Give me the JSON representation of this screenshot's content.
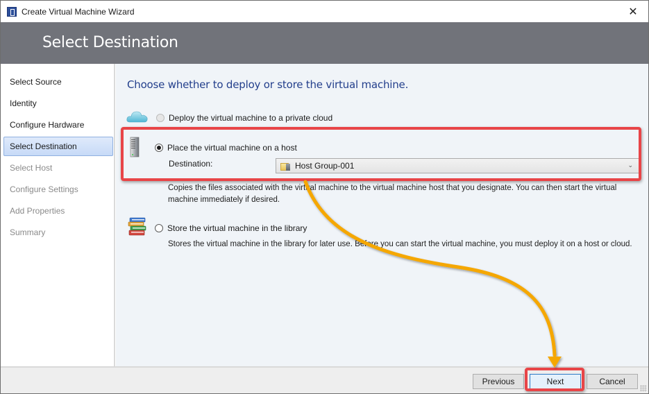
{
  "window": {
    "title": "Create Virtual Machine Wizard",
    "close_icon": "close-icon"
  },
  "header": {
    "title": "Select Destination"
  },
  "sidebar": {
    "items": [
      {
        "label": "Select Source",
        "state": "enabled"
      },
      {
        "label": "Identity",
        "state": "enabled"
      },
      {
        "label": "Configure Hardware",
        "state": "enabled"
      },
      {
        "label": "Select Destination",
        "state": "active"
      },
      {
        "label": "Select Host",
        "state": "disabled"
      },
      {
        "label": "Configure Settings",
        "state": "disabled"
      },
      {
        "label": "Add Properties",
        "state": "disabled"
      },
      {
        "label": "Summary",
        "state": "disabled"
      }
    ]
  },
  "main": {
    "heading": "Choose whether to deploy or store the virtual machine.",
    "options": [
      {
        "label": "Deploy the virtual machine to a private cloud",
        "icon": "cloud-icon",
        "checked": false,
        "enabled": false
      },
      {
        "label": "Place the virtual machine on a host",
        "icon": "server-icon",
        "checked": true,
        "enabled": true,
        "destination_label": "Destination:",
        "destination_value": "Host Group-001",
        "destination_icon": "host-group-folder-icon",
        "description": "Copies the files associated with the virtual machine to the virtual machine host that you designate. You can then start the virtual machine immediately if desired."
      },
      {
        "label": "Store the virtual machine in the library",
        "icon": "library-books-icon",
        "checked": false,
        "enabled": true,
        "description": "Stores the virtual machine in the library for later use. Before you can start the virtual machine, you must deploy it on a host or cloud."
      }
    ]
  },
  "footer": {
    "previous_label": "Previous",
    "next_label": "Next",
    "cancel_label": "Cancel"
  },
  "annotations": {
    "highlight_color": "#e84548",
    "arrow_color": "#f5a700"
  }
}
